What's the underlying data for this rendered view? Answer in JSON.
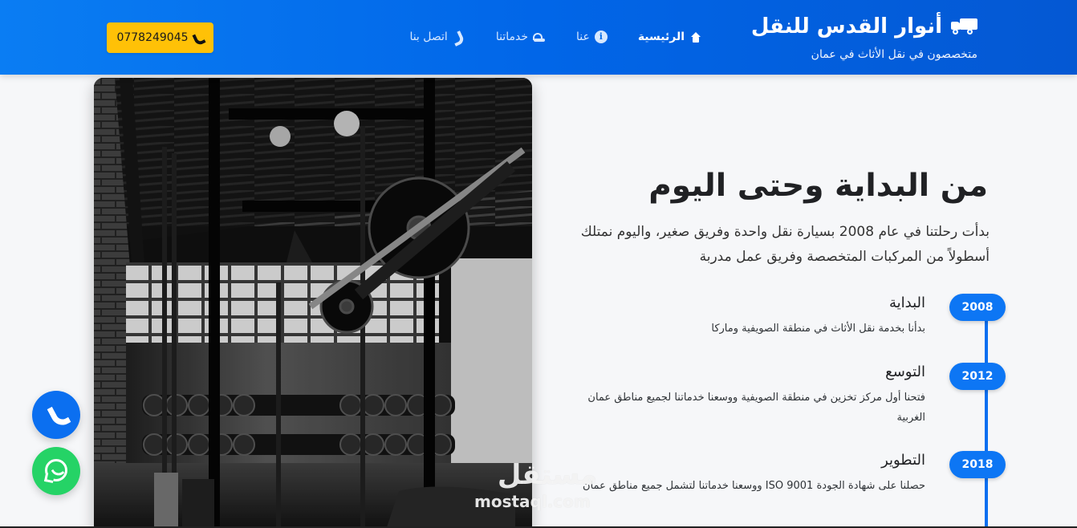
{
  "header": {
    "brand": {
      "title": "أنوار القدس للنقل",
      "subtitle": "متخصصون في نقل الأثاث في عمان",
      "icon": "truck-icon"
    },
    "nav": [
      {
        "label": "الرئيسية",
        "icon": "home-icon",
        "active": true
      },
      {
        "label": "عنا",
        "icon": "info-icon",
        "active": false
      },
      {
        "label": "خدماتنا",
        "icon": "service-icon",
        "active": false
      },
      {
        "label": "اتصل بنا",
        "icon": "phone-icon",
        "active": false
      }
    ],
    "phone": {
      "number": "0778249045",
      "icon": "phone-icon",
      "color": "#ffc107"
    }
  },
  "about": {
    "title": "من البداية وحتى اليوم",
    "intro": "بدأت رحلتنا في عام 2008 بسيارة نقل واحدة وفريق صغير، واليوم نمتلك أسطولاً من المركبات المتخصصة وفريق عمل مدربة",
    "timeline": [
      {
        "year": "2008",
        "title": "البداية",
        "text": "بدأنا بخدمة نقل الأثاث في منطقة الصويفية وماركا"
      },
      {
        "year": "2012",
        "title": "التوسع",
        "text": "فتحنا أول مركز تخزين في منطقة الصويفية ووسعنا خدماتنا لجميع مناطق عمان الغربية"
      },
      {
        "year": "2018",
        "title": "التطوير",
        "text": "حصلنا على شهادة الجودة ISO 9001 ووسعنا خدماتنا لتشمل جميع مناطق عمان"
      }
    ]
  },
  "floating_buttons": {
    "call": {
      "icon": "phone-icon",
      "color": "#0b6ff0"
    },
    "whatsapp": {
      "icon": "whatsapp-icon",
      "color": "#25d366"
    }
  },
  "watermark": {
    "arabic": "مستقل",
    "latin": "mostaql.com"
  },
  "colors": {
    "primary": "#0b6ff0",
    "accent": "#ffc107",
    "background": "#f6f7f9"
  }
}
